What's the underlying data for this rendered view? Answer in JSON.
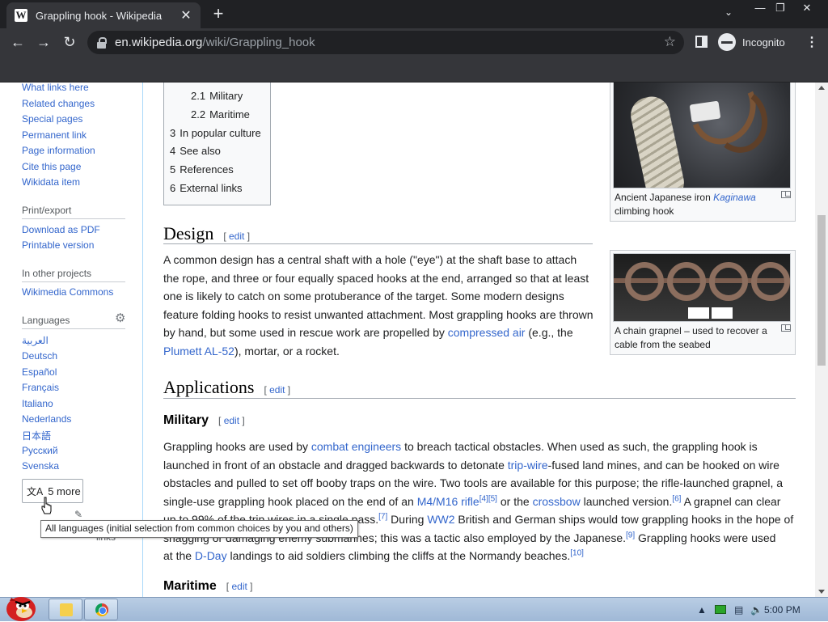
{
  "browser": {
    "tab_title": "Grappling hook - Wikipedia",
    "favicon": "W",
    "url_host": "en.wikipedia.org",
    "url_path": "/wiki/Grappling_hook",
    "incognito_label": "Incognito"
  },
  "sidebar": {
    "tools": [
      "What links here",
      "Related changes",
      "Special pages",
      "Permanent link",
      "Page information",
      "Cite this page",
      "Wikidata item"
    ],
    "print_heading": "Print/export",
    "print": [
      "Download as PDF",
      "Printable version"
    ],
    "projects_heading": "In other projects",
    "projects": [
      "Wikimedia Commons"
    ],
    "languages_heading": "Languages",
    "languages": [
      "العربية",
      "Deutsch",
      "Español",
      "Français",
      "Italiano",
      "Nederlands",
      "日本語",
      "Русский",
      "Svenska"
    ],
    "more_label": "5 more",
    "edit_links": "Edit links",
    "tooltip": "All languages (initial selection from common choices by you and others)"
  },
  "toc": [
    {
      "num": "2.1",
      "label": "Military"
    },
    {
      "num": "2.2",
      "label": "Maritime"
    },
    {
      "num": "3",
      "label": "In popular culture"
    },
    {
      "num": "4",
      "label": "See also"
    },
    {
      "num": "5",
      "label": "References"
    },
    {
      "num": "6",
      "label": "External links"
    }
  ],
  "edit_label": "edit",
  "design": {
    "heading": "Design",
    "p1": "A common design has a central shaft with a hole (\"eye\") at the shaft base to attach",
    "p2": "the rope, and three or four equally spaced hooks at the end, arranged so that at least",
    "p3": "one is likely to catch on some protuberance of the target. Some modern designs",
    "p4": "feature folding hooks to resist unwanted attachment. Most grappling hooks are thrown",
    "p5a": "by hand, but some used in rescue work are propelled by ",
    "link_air": "compressed air",
    "p5b": " (e.g., the",
    "link_plumett": "Plumett AL-52",
    "p6": "), mortar, or a rocket."
  },
  "applications": {
    "heading": "Applications"
  },
  "military": {
    "heading": "Military",
    "l1a": "Grappling hooks are used by ",
    "link_combat": "combat engineers",
    "l1b": " to breach tactical obstacles. When used as such, the grappling hook is",
    "l2a": "launched in front of an obstacle and dragged backwards to detonate ",
    "link_trip": "trip-wire",
    "l2b": "-fused land mines, and can be hooked on wire",
    "l3": "obstacles and pulled to set off booby traps on the wire. Two tools are available for this purpose; the rifle-launched grapnel, a",
    "l4a": "single-use grappling hook placed on the end of an ",
    "link_m4": "M4/M16 rifle",
    "ref45": "[4][5]",
    "l4b": " or the ",
    "link_crossbow": "crossbow",
    "l4c": " launched version.",
    "ref6": "[6]",
    "l4d": " A grapnel can clear",
    "l5a": "up to 99% of the trip wires in a single pass.",
    "ref7": "[7]",
    "l5b": " During ",
    "link_ww2": "WW2",
    "l5c": " British and German ships would tow grappling hooks in the hope of",
    "l6a": "snagging or damaging enemy submarines;",
    "l6b": " this was a tactic also employed by the Japanese.",
    "ref9": "[9]",
    "l6c": " Grappling hooks were used",
    "l7a": "at the ",
    "link_dday": "D-Day",
    "l7b": " landings to aid soldiers climbing the cliffs at the Normandy beaches.",
    "ref10": "[10]"
  },
  "maritime": {
    "heading": "Maritime"
  },
  "figures": {
    "hook_caption_a": "Ancient Japanese iron ",
    "hook_caption_italic": "Kaginawa",
    "hook_caption_b": "climbing hook",
    "grapnel_caption_a": "A chain grapnel – used to recover a",
    "grapnel_caption_b": "cable from the seabed"
  },
  "taskbar": {
    "clock": "5:00 PM"
  }
}
